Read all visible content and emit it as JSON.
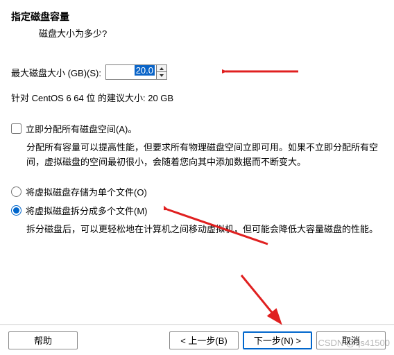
{
  "header": {
    "title": "指定磁盘容量",
    "subtitle": "磁盘大小为多少?"
  },
  "size": {
    "label": "最大磁盘大小 (GB)(S):",
    "value": "20.0",
    "suggestion": "针对 CentOS 6 64 位 的建议大小: 20 GB"
  },
  "allocate": {
    "label": "立即分配所有磁盘空间(A)。",
    "desc": "分配所有容量可以提高性能，但要求所有物理磁盘空间立即可用。如果不立即分配所有空间，虚拟磁盘的空间最初很小，会随着您向其中添加数据而不断变大。"
  },
  "storage": {
    "single": "将虚拟磁盘存储为单个文件(O)",
    "split": "将虚拟磁盘拆分成多个文件(M)",
    "split_desc": "拆分磁盘后，可以更轻松地在计算机之间移动虚拟机，但可能会降低大容量磁盘的性能。"
  },
  "buttons": {
    "help": "帮助",
    "back": "< 上一步(B)",
    "next": "下一步(N) >",
    "cancel": "取消"
  },
  "watermark": "CSDN @qs41500"
}
